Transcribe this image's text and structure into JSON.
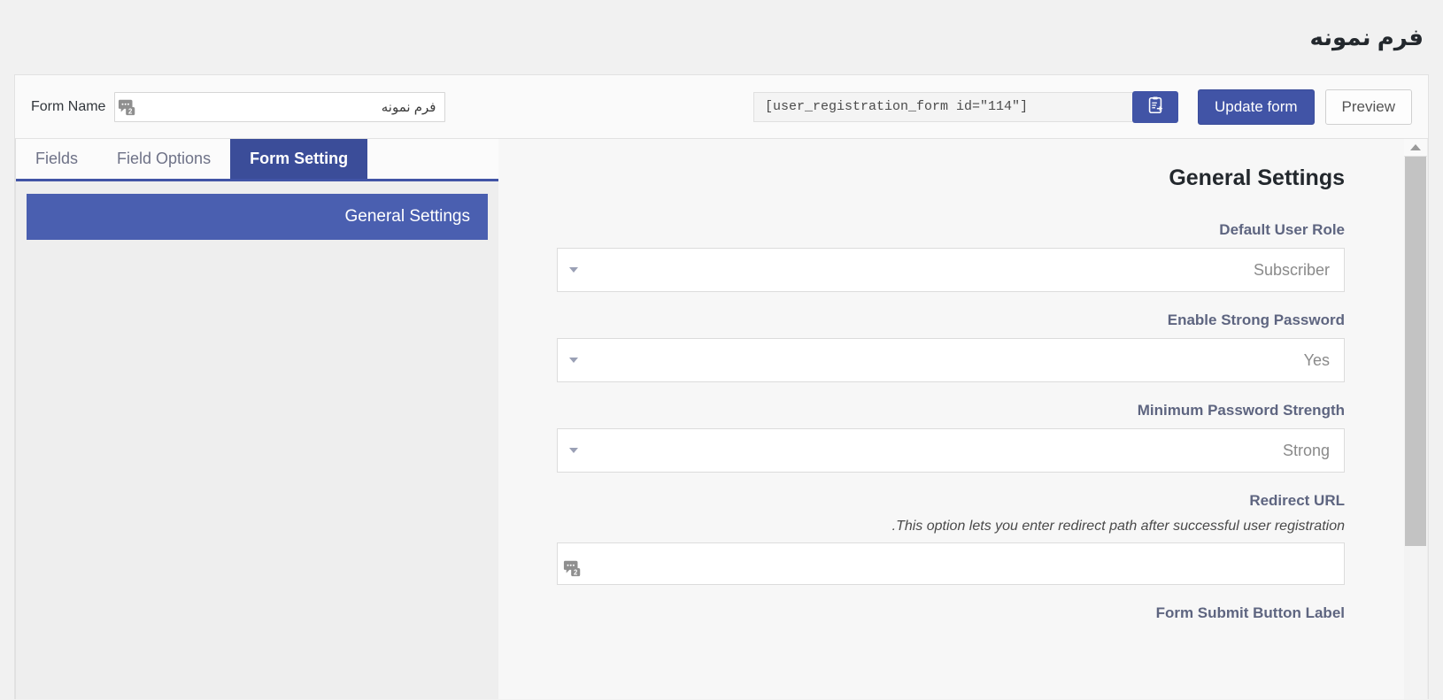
{
  "page": {
    "title": "فرم نمونه"
  },
  "toolbar": {
    "form_name_label": "Form Name",
    "form_name_value": "فرم نمونه",
    "form_name_placeholder": "Form Name",
    "shortcode": "[user_registration_form id=\"114\"]",
    "copy_icon": "clipboard-copy-icon",
    "translation_badge_icon": "translation-badge-icon",
    "update_label": "Update form",
    "preview_label": "Preview"
  },
  "sidebar": {
    "tabs": [
      {
        "label": "Fields",
        "active": false
      },
      {
        "label": "Field Options",
        "active": false
      },
      {
        "label": "Form Setting",
        "active": true
      }
    ],
    "items": [
      {
        "label": "General Settings",
        "active": true
      }
    ]
  },
  "canvas": {
    "section_title": "General Settings",
    "fields": [
      {
        "label": "Default User Role",
        "type": "select",
        "value": "Subscriber",
        "help": ""
      },
      {
        "label": "Enable Strong Password",
        "type": "select",
        "value": "Yes",
        "help": ""
      },
      {
        "label": "Minimum Password Strength",
        "type": "select",
        "value": "Strong",
        "help": ""
      },
      {
        "label": "Redirect URL",
        "type": "text",
        "value": "",
        "placeholder": "",
        "help": "This option lets you enter redirect path after successful user registration."
      },
      {
        "label": "Form Submit Button Label",
        "type": "text",
        "value": "",
        "placeholder": "",
        "help": ""
      }
    ]
  },
  "colors": {
    "accent": "#4154a6",
    "tab_active": "#3b4d99",
    "sidebar_item": "#4a5fb0",
    "label": "#5e6580",
    "page_bg": "#f1f1f1"
  },
  "scrollbar": {
    "up_arrow_icon": "chevron-up-icon"
  }
}
